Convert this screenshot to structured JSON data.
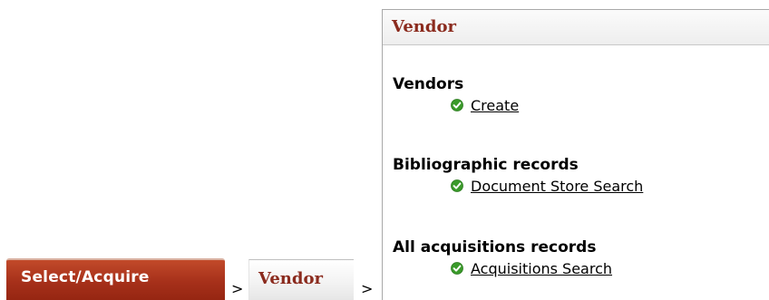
{
  "breadcrumb": {
    "select_acquire_label": "Select/Acquire",
    "separator_1": ">",
    "vendor_label": "Vendor",
    "separator_2": ">"
  },
  "panel": {
    "title": "Vendor",
    "sections": [
      {
        "title": "Vendors",
        "link": "Create",
        "icon": "check-icon"
      },
      {
        "title": "Bibliographic records",
        "link": "Document Store Search",
        "icon": "check-icon"
      },
      {
        "title": "All acquisitions records",
        "link": "Acquisitions Search",
        "icon": "check-icon"
      }
    ]
  },
  "colors": {
    "tab_red": "#a6301a",
    "heading_red": "#8b2b1e",
    "check_green": "#3a9a2a"
  }
}
